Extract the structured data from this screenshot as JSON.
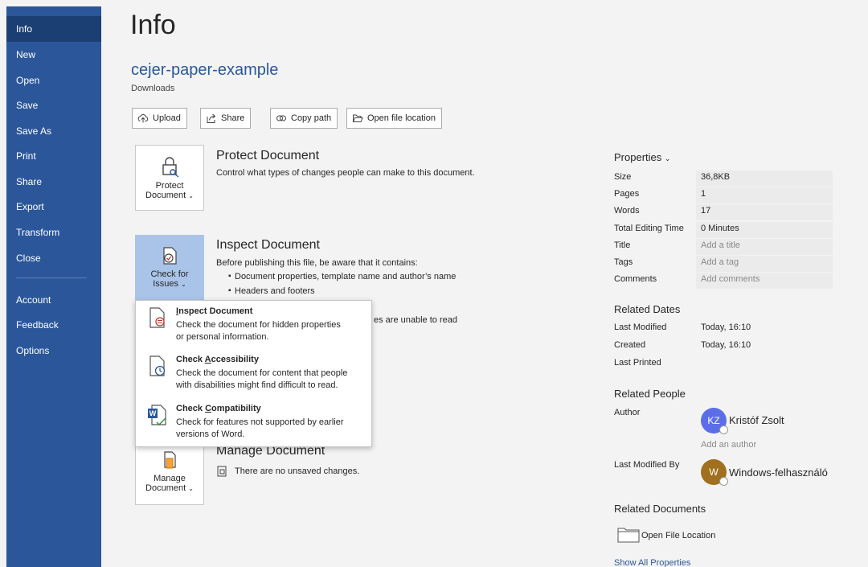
{
  "nav": {
    "items": [
      "Info",
      "New",
      "Open",
      "Save",
      "Save As",
      "Print",
      "Share",
      "Export",
      "Transform",
      "Close"
    ],
    "bottom_items": [
      "Account",
      "Feedback",
      "Options"
    ],
    "active": "Info"
  },
  "page_title": "Info",
  "document": {
    "name": "cejer-paper-example",
    "location": "Downloads"
  },
  "toolbar": {
    "upload": "Upload",
    "share": "Share",
    "copy_path": "Copy path",
    "open_location": "Open file location"
  },
  "protect": {
    "button_line1": "Protect",
    "button_line2": "Document",
    "title": "Protect Document",
    "description": "Control what types of changes people can make to this document."
  },
  "inspect": {
    "button_line1": "Check for",
    "button_line2": "Issues",
    "title": "Inspect Document",
    "description": "Before publishing this file, be aware that it contains:",
    "bullets": [
      "Document properties, template name and author’s name",
      "Headers and footers"
    ],
    "partial_text": "es are unable to read"
  },
  "menu": {
    "items": [
      {
        "title": "Inspect Document",
        "underline": "I",
        "rest": "nspect Document",
        "desc_line1": "Check the document for hidden properties",
        "desc_line2": "or personal information."
      },
      {
        "title": "Check Accessibility",
        "prefix": "Check ",
        "underline": "A",
        "rest": "ccessibility",
        "desc_line1": "Check the document for content that people",
        "desc_line2": "with disabilities might find difficult to read."
      },
      {
        "title": "Check Compatibility",
        "prefix": "Check ",
        "underline": "C",
        "rest": "ompatibility",
        "desc_line1": "Check for features not supported by earlier",
        "desc_line2": "versions of Word."
      }
    ]
  },
  "manage": {
    "button_line1": "Manage",
    "button_line2": "Document",
    "title": "Manage Document",
    "status": "There are no unsaved changes."
  },
  "properties": {
    "header": "Properties",
    "rows": [
      {
        "key": "Size",
        "value": "36,8KB",
        "muted": false
      },
      {
        "key": "Pages",
        "value": "1",
        "muted": false
      },
      {
        "key": "Words",
        "value": "17",
        "muted": false
      },
      {
        "key": "Total Editing Time",
        "value": "0 Minutes",
        "muted": false
      },
      {
        "key": "Title",
        "value": "Add a title",
        "muted": true
      },
      {
        "key": "Tags",
        "value": "Add a tag",
        "muted": true
      },
      {
        "key": "Comments",
        "value": "Add comments",
        "muted": true
      }
    ]
  },
  "related_dates": {
    "header": "Related Dates",
    "rows": [
      {
        "key": "Last Modified",
        "value": "Today, 16:10"
      },
      {
        "key": "Created",
        "value": "Today, 16:10"
      },
      {
        "key": "Last Printed",
        "value": ""
      }
    ]
  },
  "related_people": {
    "header": "Related People",
    "author_label": "Author",
    "author_initials": "KZ",
    "author_name": "Kristóf Zsolt",
    "author_color": "#5b6ee8",
    "add_author": "Add an author",
    "modified_by_label": "Last Modified By",
    "modifier_initials": "W",
    "modifier_name": "Windows-felhasználó",
    "modifier_color": "#a0701e"
  },
  "related_documents": {
    "header": "Related Documents",
    "open_location": "Open File Location"
  },
  "show_all": "Show All Properties",
  "colors": {
    "nav_bg": "#2b579a",
    "nav_active": "#1b3f73",
    "accent": "#2b579a",
    "selected_button": "#a9c4e8"
  }
}
